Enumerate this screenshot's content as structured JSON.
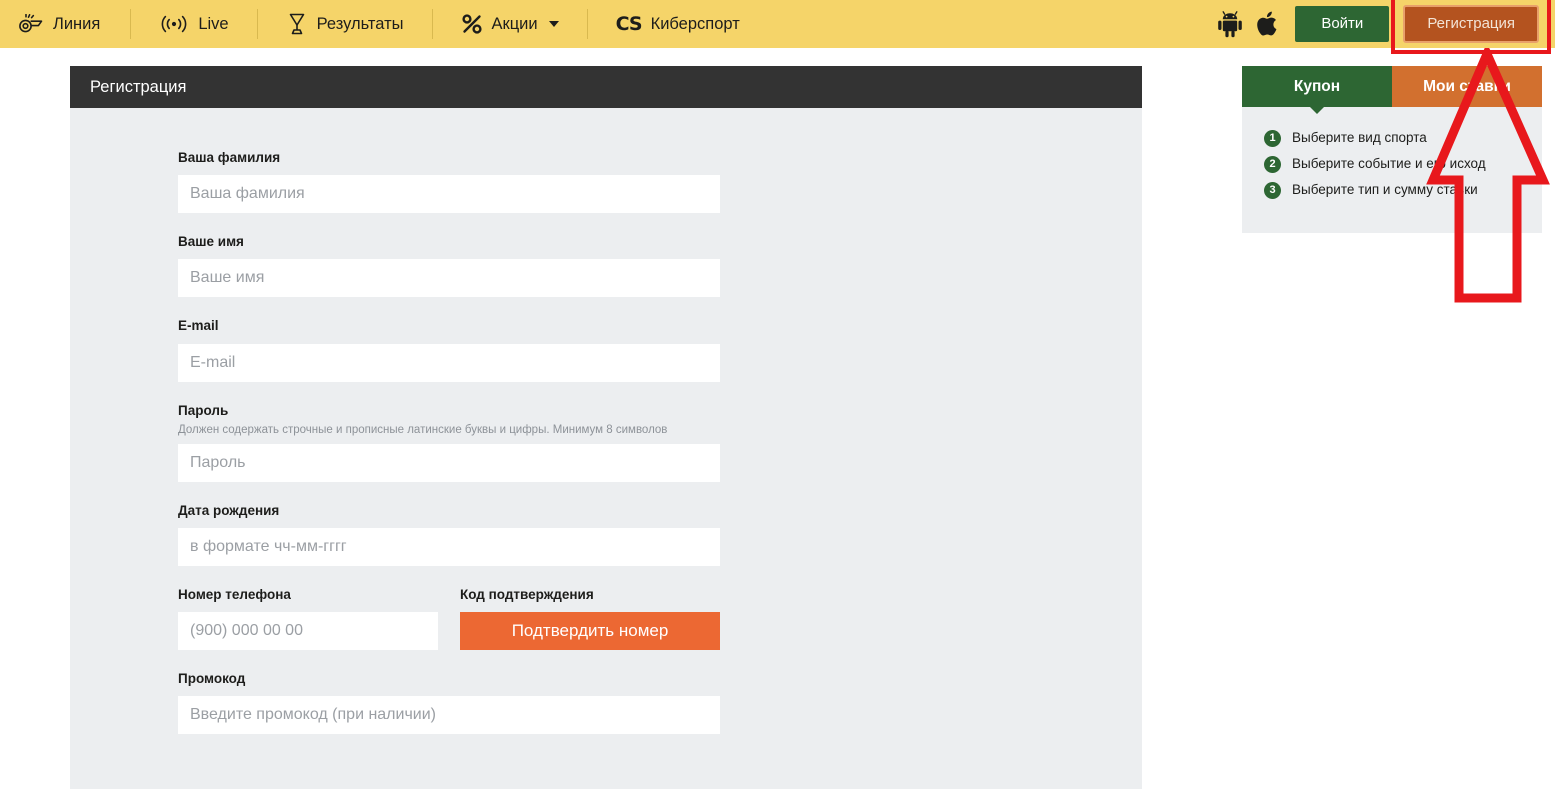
{
  "header": {
    "nav_items": [
      {
        "label": "Линия",
        "icon": "whistle-icon"
      },
      {
        "label": "Live",
        "icon": "broadcast-icon"
      },
      {
        "label": "Результаты",
        "icon": "trophy-icon"
      },
      {
        "label": "Акции",
        "icon": "percent-icon",
        "has_caret": true
      },
      {
        "label": "Киберспорт",
        "icon": "cs-logo-icon"
      }
    ],
    "cs_mark": "CS",
    "android_icon": "android-icon",
    "apple_icon": "apple-icon",
    "login_label": "Войти",
    "register_label": "Регистрация",
    "colors": {
      "bar": "#f5d469",
      "login": "#2d6633",
      "register": "#b4531f",
      "highlight": "#e8181c"
    }
  },
  "form": {
    "title": "Регистрация",
    "fields": {
      "lastname": {
        "label": "Ваша фамилия",
        "placeholder": "Ваша фамилия",
        "value": ""
      },
      "firstname": {
        "label": "Ваше имя",
        "placeholder": "Ваше имя",
        "value": ""
      },
      "email": {
        "label": "E-mail",
        "placeholder": "E-mail",
        "value": ""
      },
      "password": {
        "label": "Пароль",
        "hint": "Должен содержать строчные и прописные латинские буквы и цифры. Минимум 8 символов",
        "placeholder": "Пароль",
        "value": ""
      },
      "birthdate": {
        "label": "Дата рождения",
        "placeholder": "в формате чч-мм-гггг",
        "value": ""
      },
      "phone": {
        "label": "Номер телефона",
        "placeholder": "(900) 000 00 00",
        "value": ""
      },
      "confirmcode": {
        "label": "Код подтверждения",
        "button_label": "Подтвердить номер"
      },
      "promocode": {
        "label": "Промокод",
        "placeholder": "Введите промокод (при наличии)",
        "value": ""
      }
    }
  },
  "sidebar": {
    "tabs": [
      {
        "label": "Купон",
        "active": true
      },
      {
        "label": "Мои ставки",
        "active": false
      }
    ],
    "steps": [
      {
        "num": "1",
        "text": "Выберите вид спорта"
      },
      {
        "num": "2",
        "text": "Выберите событие и его исход"
      },
      {
        "num": "3",
        "text": "Выберите тип и сумму ставки"
      }
    ]
  },
  "annotations": {
    "arrow": {
      "name": "red-up-arrow",
      "color": "#e8181c",
      "points_to": "Регистрация"
    }
  }
}
